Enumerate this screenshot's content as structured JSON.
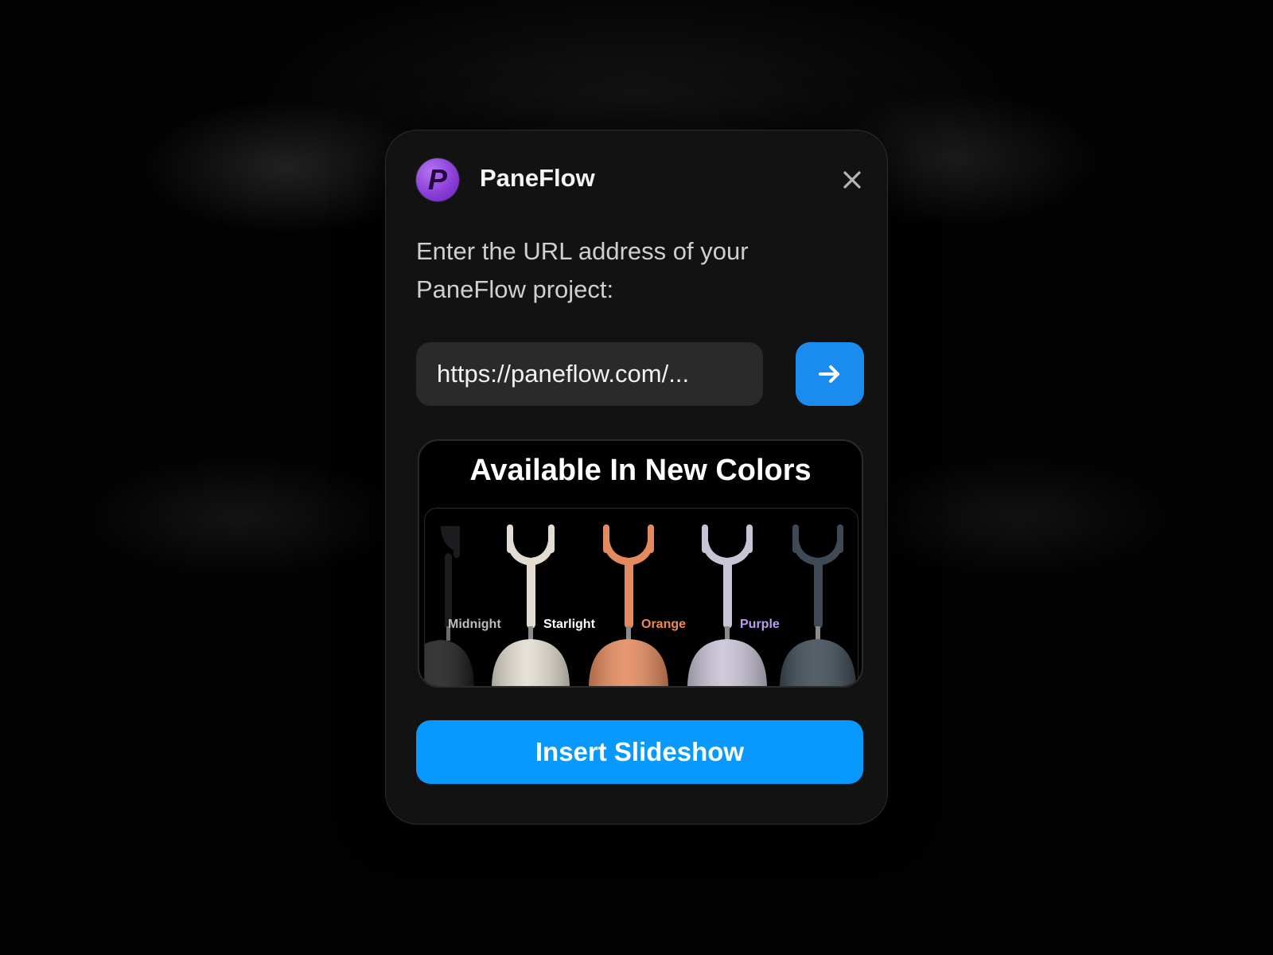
{
  "app": {
    "name": "PaneFlow",
    "icon_letter": "P",
    "icon": "paneflow-logo-icon"
  },
  "dialog": {
    "prompt": "Enter the URL address of your PaneFlow project:",
    "url_value": "https://paneflow.com/...",
    "go_icon": "arrow-right-icon",
    "close_icon": "close-icon",
    "insert_label": "Insert Slideshow"
  },
  "preview": {
    "title": "Available In New Colors",
    "colors": [
      {
        "label": "Midnight",
        "hex": "#1c1c1e",
        "label_color": "#bdbdbd"
      },
      {
        "label": "Starlight",
        "hex": "#e2ddd0",
        "label_color": "#ffffff"
      },
      {
        "label": "Orange",
        "hex": "#e58a5e",
        "label_color": "#f08a50"
      },
      {
        "label": "Purple",
        "hex": "#c9c3d6",
        "label_color": "#b99cf5"
      },
      {
        "label": "",
        "hex": "#3e4a55",
        "label_color": "#9aa7b3"
      }
    ]
  },
  "theme": {
    "background": "#020202",
    "dialog_bg": "#121212",
    "accent": "#0899ff",
    "field_bg": "#2a2a2a",
    "logo_purple": "#8b3fd9"
  }
}
